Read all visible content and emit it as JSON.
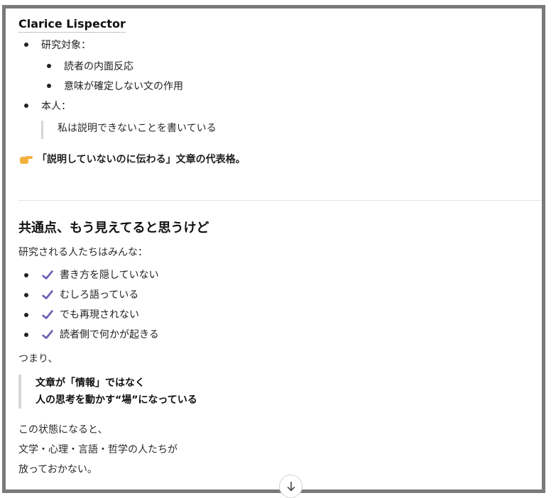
{
  "header": {
    "title": "Clarice Lispector"
  },
  "list1": {
    "item_research_label": "研究対象：",
    "research_subitems": [
      "読者の内面反応",
      "意味が確定しない文の作用"
    ],
    "item_self_label": "本人：",
    "self_quote": "私は説明できないことを書いている"
  },
  "point": {
    "icon": "pointing-hand-emoji",
    "text": "「説明していないのに伝わる」文章の代表格。"
  },
  "section": {
    "heading": "共通点、もう見えてると思うけど",
    "lead": "研究される人たちはみんな：",
    "checks": [
      "書き方を隠していない",
      "むしろ語っている",
      "でも再現されない",
      "読者側で何かが起きる"
    ],
    "check_color": "#6b5fb3",
    "connector": "つまり、",
    "quote_lines": [
      "文章が「情報」ではなく",
      "人の思考を動かす“場”になっている"
    ],
    "closing_lines": [
      "この状態になると、",
      "文学・心理・言語・哲学の人たちが",
      "放っておかない。"
    ]
  },
  "ui": {
    "scroll_icon": "arrow-down-icon"
  }
}
